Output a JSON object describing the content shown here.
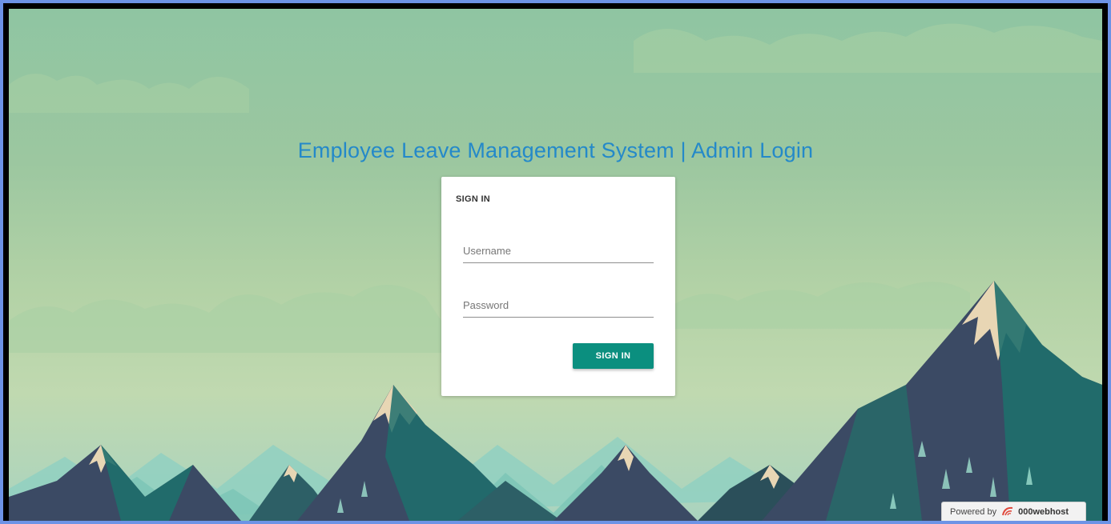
{
  "page": {
    "title": "Employee Leave Management System | Admin Login"
  },
  "login_card": {
    "heading": "SIGN IN",
    "username_placeholder": "Username",
    "username_value": "",
    "password_placeholder": "Password",
    "password_value": "",
    "submit_label": "SIGN IN"
  },
  "footer_badge": {
    "powered_text": "Powered by",
    "brand": "000webhost",
    "icon": "000webhost-logo-icon"
  },
  "colors": {
    "title": "#2489c9",
    "button": "#0b8f7f",
    "sky_top": "#8fc5a2",
    "mountain_dark": "#3a4a63",
    "mountain_teal": "#1f6f6c",
    "snow": "#e8d6b4"
  }
}
